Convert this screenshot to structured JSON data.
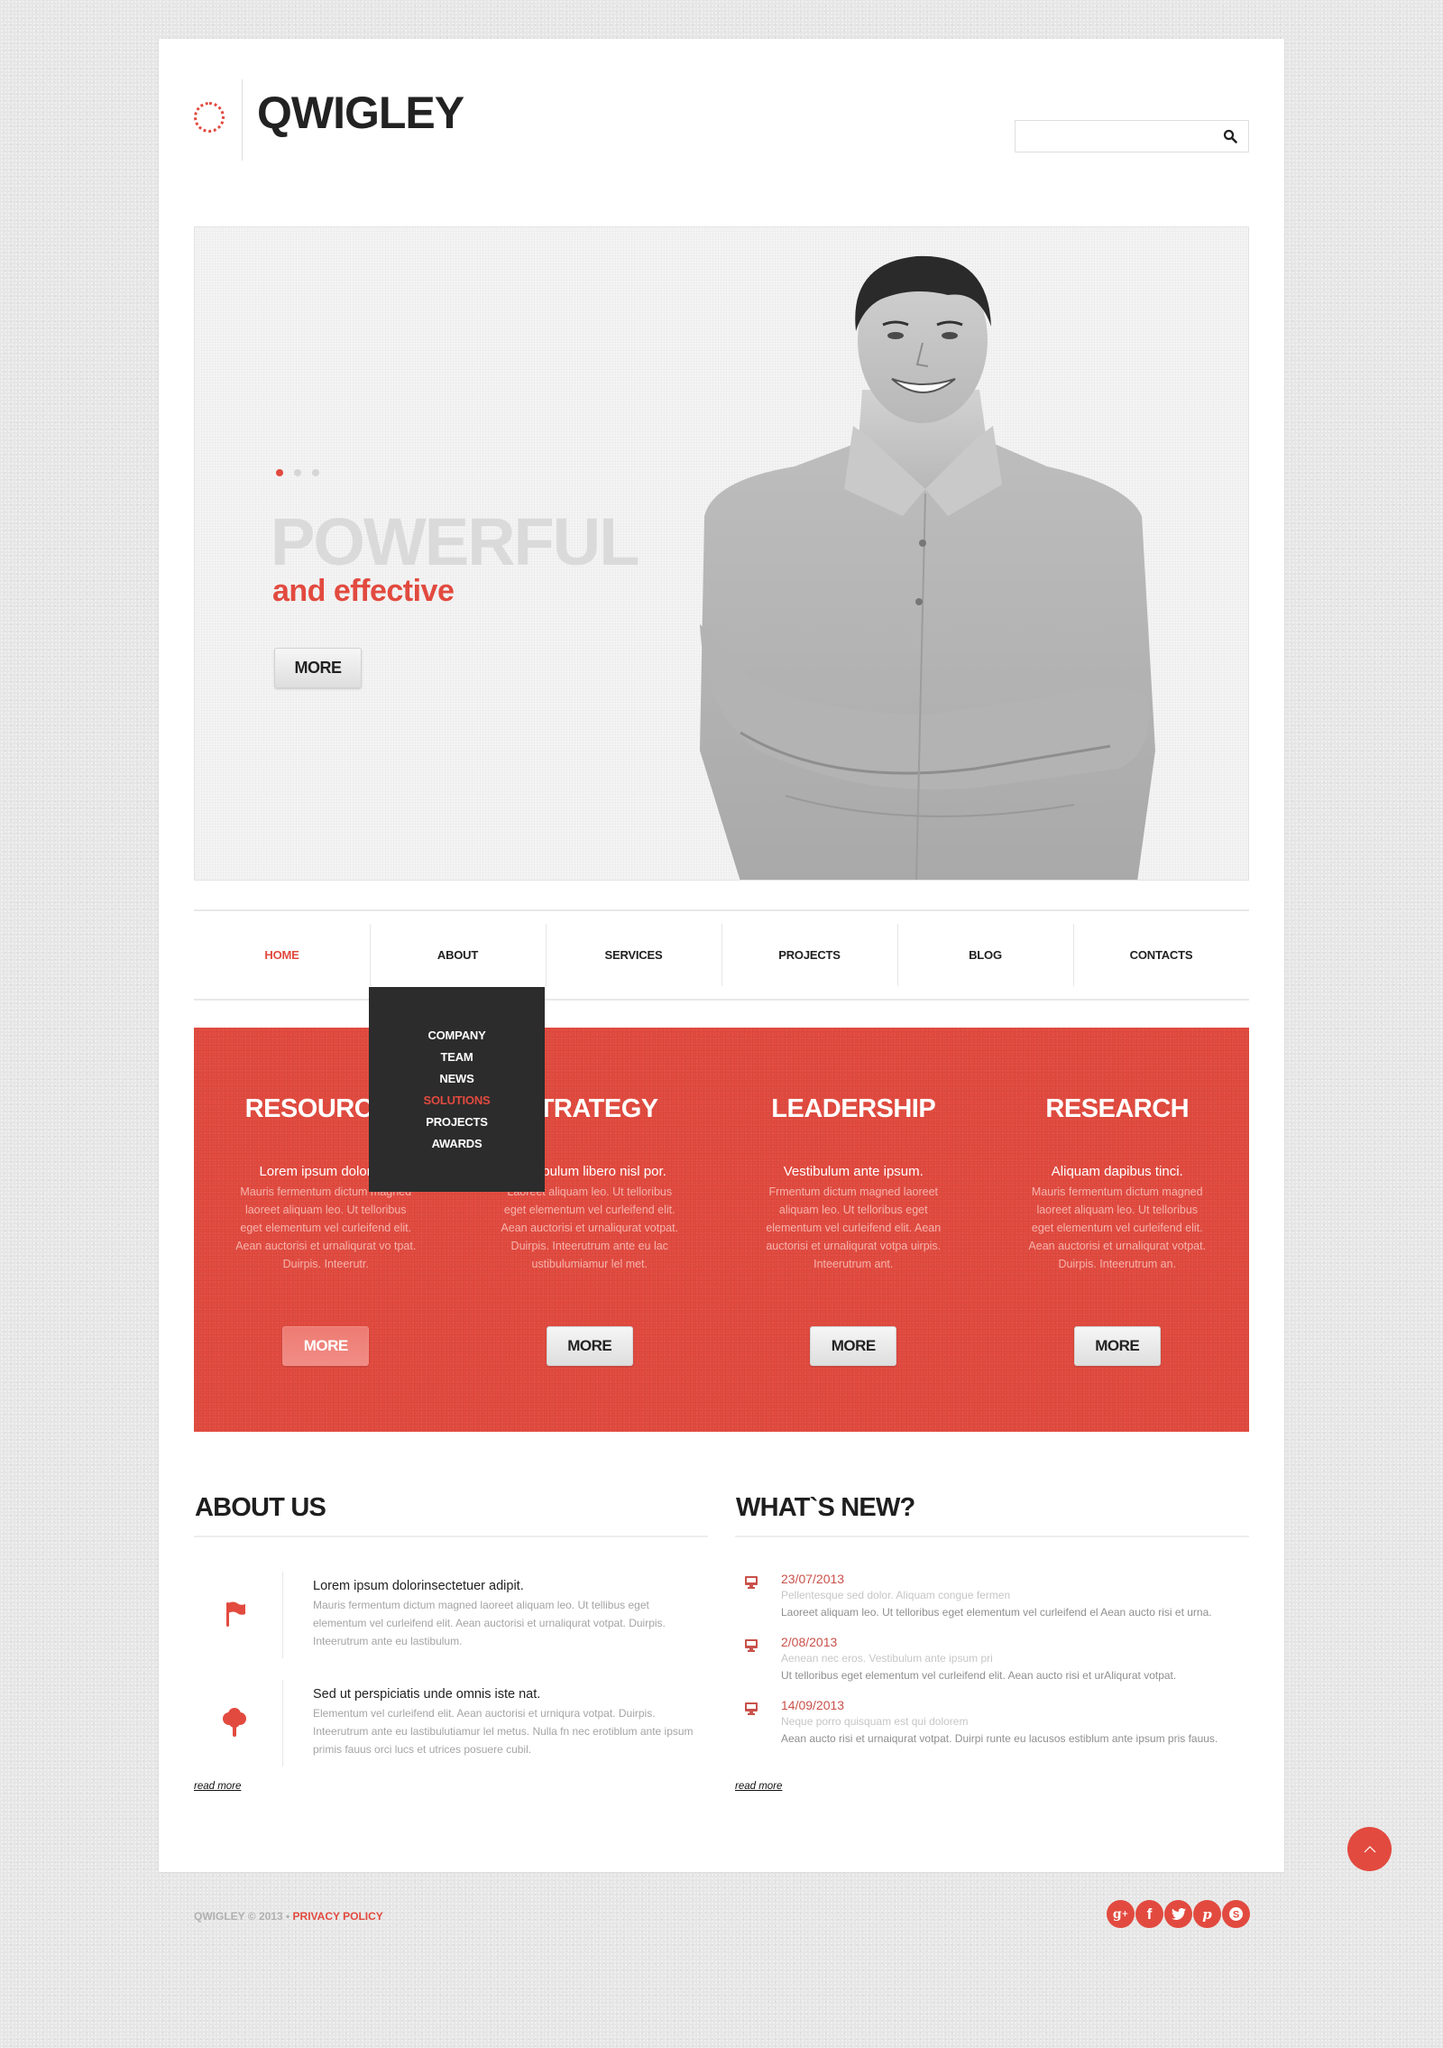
{
  "brand": {
    "name": "QWIGLEY",
    "accent_color": "#e24a3f"
  },
  "search": {
    "placeholder": "",
    "value": "",
    "icon": "search-icon"
  },
  "hero": {
    "slides_count": 3,
    "active_slide": 1,
    "title": "POWERFUL",
    "subtitle": "and effective",
    "button_label": "MORE",
    "image": "smiling-man-arms-crossed-photo"
  },
  "nav": {
    "items": [
      {
        "label": "HOME",
        "active": true
      },
      {
        "label": "ABOUT",
        "active": false
      },
      {
        "label": "SERVICES",
        "active": false
      },
      {
        "label": "PROJECTS",
        "active": false
      },
      {
        "label": "BLOG",
        "active": false
      },
      {
        "label": "CONTACTS",
        "active": false
      }
    ],
    "dropdown": {
      "parent": "ABOUT",
      "items": [
        {
          "label": "COMPANY",
          "active": false
        },
        {
          "label": "TEAM",
          "active": false
        },
        {
          "label": "NEWS",
          "active": false
        },
        {
          "label": "SOLUTIONS",
          "active": true
        },
        {
          "label": "PROJECTS",
          "active": false
        },
        {
          "label": "AWARDS",
          "active": false
        }
      ]
    }
  },
  "features": [
    {
      "title": "RESOURCES",
      "lead": "Lorem ipsum dolor sit.",
      "text": "Mauris fermentum dictum magned laoreet aliquam leo. Ut telloribus eget elementum vel curleifend elit. Aean auctorisi et urnaliqurat vo tpat. Duirpis. Inteerutr.",
      "button_label": "MORE",
      "button_hover": true
    },
    {
      "title": "STRATEGY",
      "lead": "Vestibulum libero nisl por.",
      "text": "Laoreet aliquam leo. Ut telloribus eget elementum vel curleifend elit. Aean auctorisi et urnaliqurat votpat. Duirpis. Inteerutrum ante eu lac ustibulumiamur lel met.",
      "button_label": "MORE",
      "button_hover": false
    },
    {
      "title": "LEADERSHIP",
      "lead": "Vestibulum ante ipsum.",
      "text": "Frmentum dictum magned laoreet aliquam leo. Ut telloribus eget elementum vel curleifend elit. Aean auctorisi et urnaliqurat votpa uirpis. Inteerutrum ant.",
      "button_label": "MORE",
      "button_hover": false
    },
    {
      "title": "RESEARCH",
      "lead": "Aliquam dapibus tinci.",
      "text": "Mauris fermentum dictum magned laoreet aliquam leo. Ut telloribus eget elementum vel curleifend elit. Aean auctorisi et urnaliqurat votpat. Duirpis. Inteerutrum an.",
      "button_label": "MORE",
      "button_hover": false
    }
  ],
  "about": {
    "heading": "ABOUT US",
    "items": [
      {
        "icon": "flag-icon",
        "title": "Lorem ipsum dolorinsectetuer adipit.",
        "text": "Mauris fermentum dictum magned laoreet aliquam leo. Ut tellibus eget elementum vel curleifend elit. Aean auctorisi et urnaliqurat votpat. Duirpis. Inteerutrum ante eu lastibulum."
      },
      {
        "icon": "tree-icon",
        "title": "Sed ut perspiciatis unde omnis iste nat.",
        "text": "Elementum vel curleifend elit. Aean auctorisi et urniqura votpat. Duirpis. Inteerutrum ante eu lastibulutiamur lel metus. Nulla fn nec erotiblum ante ipsum primis fauus orci lucs et utrices posuere cubil."
      }
    ],
    "read_more": "read more"
  },
  "news": {
    "heading": "WHAT`S NEW?",
    "items": [
      {
        "icon": "monitor-icon",
        "date": "23/07/2013",
        "subtitle": "Pellentesque sed dolor. Aliquam congue fermen",
        "text": "Laoreet aliquam leo. Ut telloribus eget elementum vel curleifend el Aean aucto risi et urna."
      },
      {
        "icon": "monitor-icon",
        "date": "2/08/2013",
        "subtitle": "Aenean nec eros. Vestibulum ante ipsum pri",
        "text": "Ut telloribus eget elementum vel curleifend elit. Aean aucto risi et urAliqurat votpat."
      },
      {
        "icon": "monitor-icon",
        "date": "14/09/2013",
        "subtitle": "Neque porro quisquam est qui dolorem",
        "text": "Aean aucto risi et urnaiqurat votpat. Duirpi runte eu lacusos estiblum ante ipsum pris fauus."
      }
    ],
    "read_more": "read more"
  },
  "footer": {
    "copyright": "QWIGLEY © 2013 •",
    "privacy_label": "PRIVACY POLICY",
    "social": [
      {
        "name": "google-plus",
        "glyph": "g+"
      },
      {
        "name": "facebook",
        "glyph": "f"
      },
      {
        "name": "twitter",
        "glyph": "t"
      },
      {
        "name": "pinterest",
        "glyph": "p"
      },
      {
        "name": "skype",
        "glyph": "S"
      }
    ],
    "scroll_top_icon": "chevron-up-icon"
  }
}
